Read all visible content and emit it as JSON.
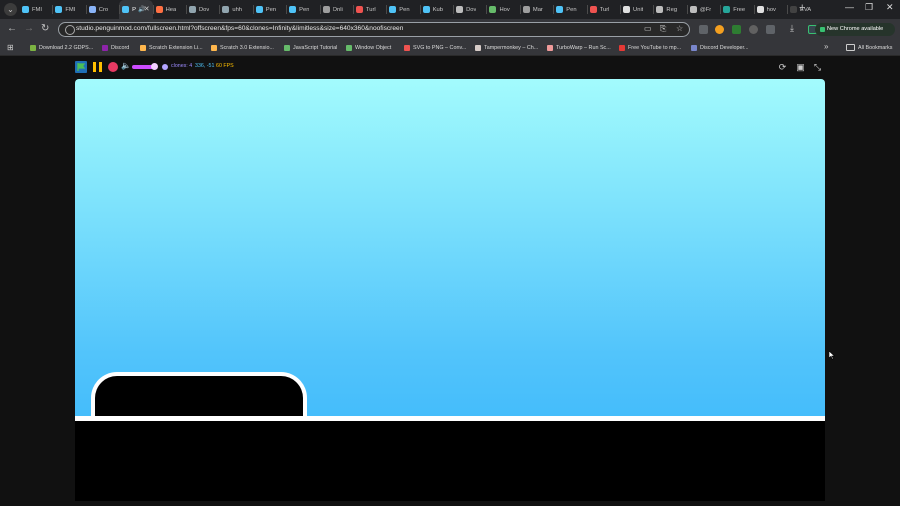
{
  "browser": {
    "tabs": [
      {
        "title": "FMI",
        "color": "#4fc3f7"
      },
      {
        "title": "FMI",
        "color": "#4fc3f7"
      },
      {
        "title": "Cro",
        "color": "#8ab4f8"
      },
      {
        "title": "P",
        "color": "#4fc3f7",
        "active": true
      },
      {
        "title": "Hea",
        "color": "#ff7043"
      },
      {
        "title": "Dov",
        "color": "#90a4ae"
      },
      {
        "title": "uhh",
        "color": "#90a4ae"
      },
      {
        "title": "Pen",
        "color": "#4fc3f7"
      },
      {
        "title": "Pen",
        "color": "#4fc3f7"
      },
      {
        "title": "Onli",
        "color": "#9e9e9e"
      },
      {
        "title": "Turl",
        "color": "#ef5350"
      },
      {
        "title": "Pen",
        "color": "#4fc3f7"
      },
      {
        "title": "Kub",
        "color": "#4fc3f7"
      },
      {
        "title": "Dov",
        "color": "#bdbdbd"
      },
      {
        "title": "Hov",
        "color": "#66bb6a"
      },
      {
        "title": "Mar",
        "color": "#9e9e9e"
      },
      {
        "title": "Pen",
        "color": "#4fc3f7"
      },
      {
        "title": "Turl",
        "color": "#ef5350"
      },
      {
        "title": "Unit",
        "color": "#e0e0e0"
      },
      {
        "title": "Reg",
        "color": "#bdbdbd"
      },
      {
        "title": "@Fr",
        "color": "#bdbdbd"
      },
      {
        "title": "Free",
        "color": "#26a69a"
      },
      {
        "title": "hov",
        "color": "#e0e0e0"
      },
      {
        "title": "EVA",
        "color": "#424242"
      }
    ],
    "new_tab_label": "+",
    "window_controls": {
      "minimize": "—",
      "restore": "❐",
      "close": "✕"
    },
    "url": "studio.penguinmod.com/fullscreen.html?offscreen&fps=60&clones=Infinity&limitless&size=640x360&noofiscreen",
    "update_label": "New Chrome available",
    "bookmarks": [
      {
        "label": "Download 2.2 GDPS...",
        "color": "#7cb342"
      },
      {
        "label": "Discord",
        "color": "#8e24aa"
      },
      {
        "label": "Scratch Extension Li...",
        "color": "#ffb74d"
      },
      {
        "label": "Scratch 3.0 Extensio...",
        "color": "#ffb74d"
      },
      {
        "label": "JavaScript Tutorial",
        "color": "#66bb6a"
      },
      {
        "label": "Window Object",
        "color": "#66bb6a"
      },
      {
        "label": "SVG to PNG – Conv...",
        "color": "#ef5350"
      },
      {
        "label": "Tampermonkey – Ch...",
        "color": "#d7ccc8"
      },
      {
        "label": "TurboWarp – Run Sc...",
        "color": "#ef9a9a"
      },
      {
        "label": "Free YouTube to mp...",
        "color": "#e53935"
      },
      {
        "label": "Discord Developer...",
        "color": "#7986cb"
      }
    ],
    "all_bookmarks_label": "All Bookmarks"
  },
  "player": {
    "clones_label": "clones: 4",
    "mouse_label": "336, -51",
    "fps_label": "60 FPS",
    "colors": {
      "flag": "#1f6fb6",
      "pause": "#ffbf00",
      "stop": "#e83a63",
      "volume": "#cc4cff"
    }
  },
  "stage": {
    "sky_top": "#a3fbfd",
    "sky_bottom": "#33b3fb",
    "ground": "#000000",
    "outline": "#ffffff"
  }
}
